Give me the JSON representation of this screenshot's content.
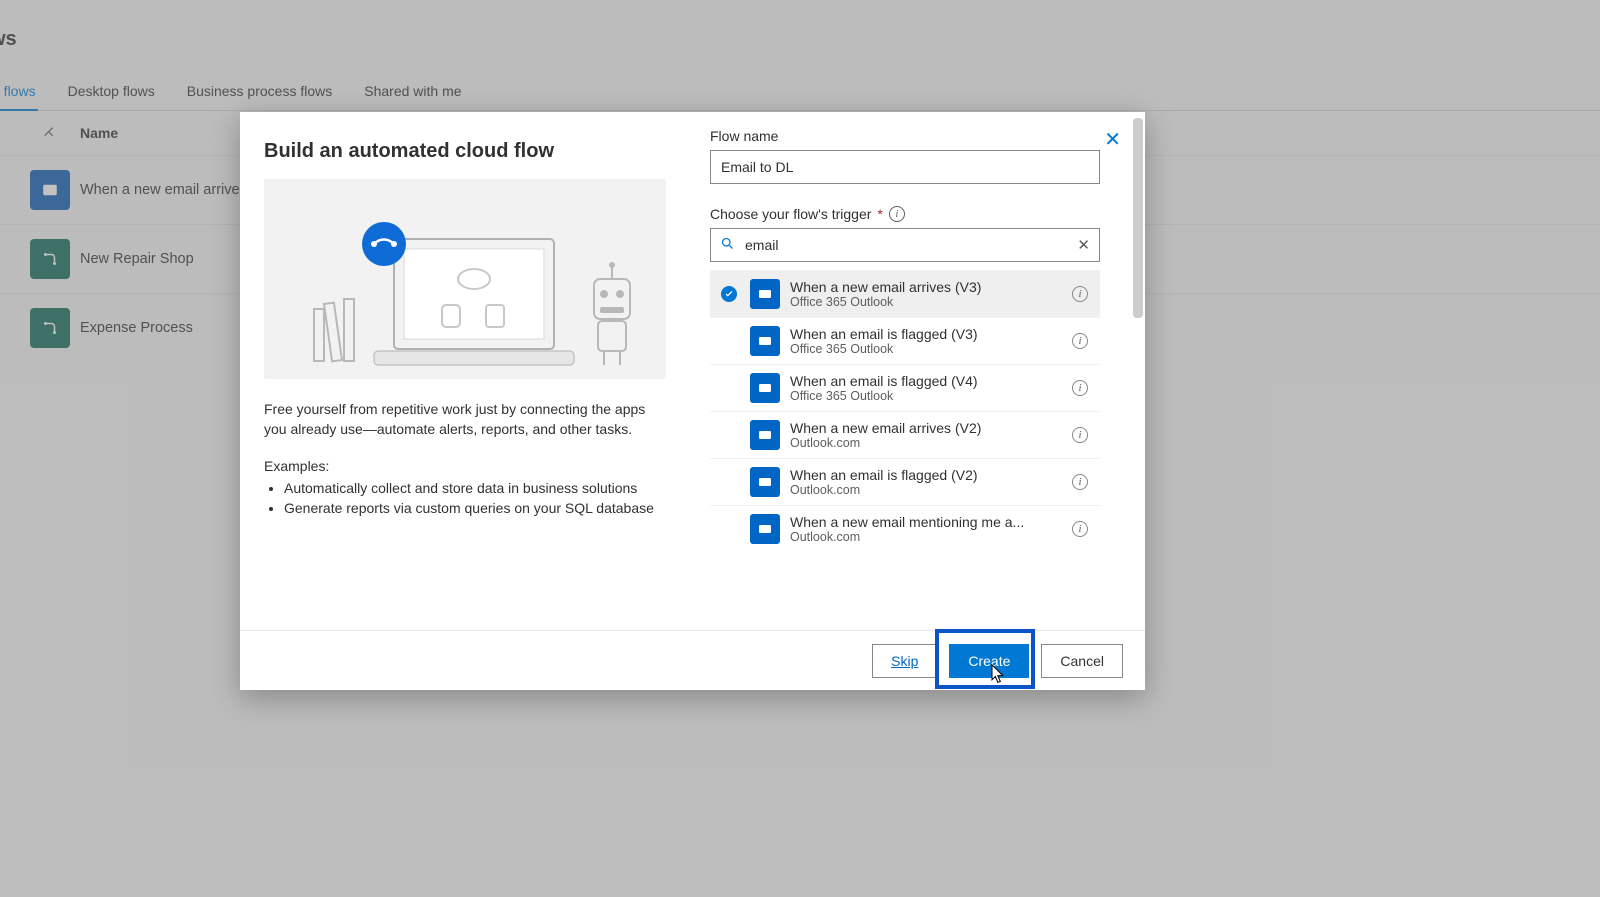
{
  "page": {
    "heading": "ws",
    "tabs": [
      "d flows",
      "Desktop flows",
      "Business process flows",
      "Shared with me"
    ],
    "active_tab_index": 0,
    "columns": {
      "name": "Name"
    },
    "flows": [
      {
        "name": "When a new email arrives",
        "icon": "outlook"
      },
      {
        "name": "New Repair Shop",
        "icon": "teal"
      },
      {
        "name": "Expense Process",
        "icon": "teal"
      }
    ]
  },
  "modal": {
    "title": "Build an automated cloud flow",
    "description": "Free yourself from repetitive work just by connecting the apps you already use—automate alerts, reports, and other tasks.",
    "examples_heading": "Examples:",
    "examples": [
      "Automatically collect and store data in business solutions",
      "Generate reports via custom queries on your SQL database"
    ],
    "flow_name_label": "Flow name",
    "flow_name_value": "Email to DL",
    "trigger_label": "Choose your flow's trigger",
    "trigger_required": "*",
    "search_value": "email",
    "triggers": [
      {
        "title": "When a new email arrives (V3)",
        "connector": "Office 365 Outlook",
        "selected": true
      },
      {
        "title": "When an email is flagged (V3)",
        "connector": "Office 365 Outlook",
        "selected": false
      },
      {
        "title": "When an email is flagged (V4)",
        "connector": "Office 365 Outlook",
        "selected": false
      },
      {
        "title": "When a new email arrives (V2)",
        "connector": "Outlook.com",
        "selected": false
      },
      {
        "title": "When an email is flagged (V2)",
        "connector": "Outlook.com",
        "selected": false
      },
      {
        "title": "When a new email mentioning me a...",
        "connector": "Outlook.com",
        "selected": false
      }
    ],
    "buttons": {
      "skip": "Skip",
      "create": "Create",
      "cancel": "Cancel"
    }
  }
}
